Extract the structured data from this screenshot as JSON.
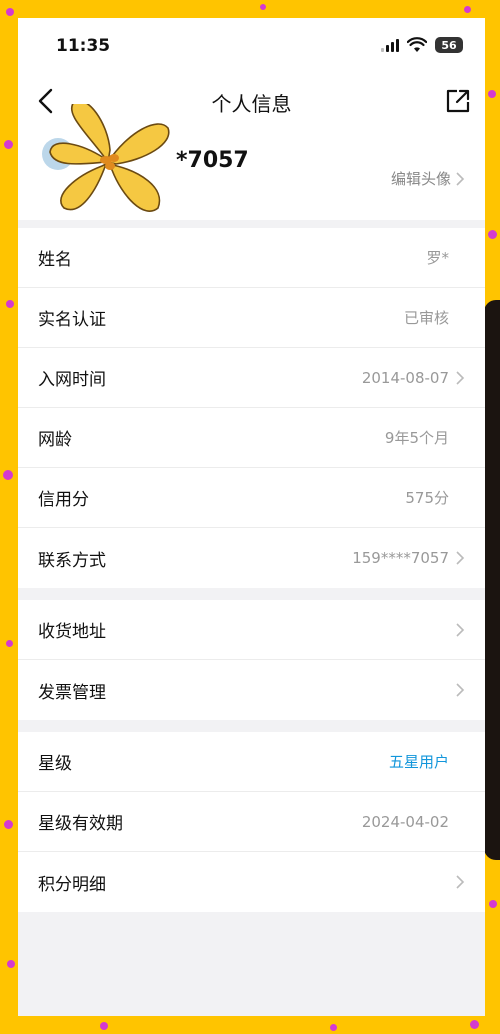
{
  "status_bar": {
    "time": "11:35",
    "battery": "56"
  },
  "nav": {
    "title": "个人信息"
  },
  "profile": {
    "masked_id": "*7057",
    "edit_avatar_label": "编辑头像"
  },
  "section1": [
    {
      "label": "姓名",
      "value": "罗*",
      "chevron": false
    },
    {
      "label": "实名认证",
      "value": "已审核",
      "chevron": false
    },
    {
      "label": "入网时间",
      "value": "2014-08-07",
      "chevron": true
    },
    {
      "label": "网龄",
      "value": "9年5个月",
      "chevron": false
    },
    {
      "label": "信用分",
      "value": "575分",
      "chevron": false
    },
    {
      "label": "联系方式",
      "value": "159****7057",
      "chevron": true
    }
  ],
  "section2": [
    {
      "label": "收货地址",
      "value": "",
      "chevron": true
    },
    {
      "label": "发票管理",
      "value": "",
      "chevron": true
    }
  ],
  "section3": [
    {
      "label": "星级",
      "value": "五星用户",
      "chevron": false
    },
    {
      "label": "星级有效期",
      "value": "2024-04-02",
      "chevron": false
    },
    {
      "label": "积分明细",
      "value": "",
      "chevron": true
    }
  ],
  "colors": {
    "frame": "#ffc400",
    "dots": "#d43ad0",
    "star_value": "#1296db"
  }
}
